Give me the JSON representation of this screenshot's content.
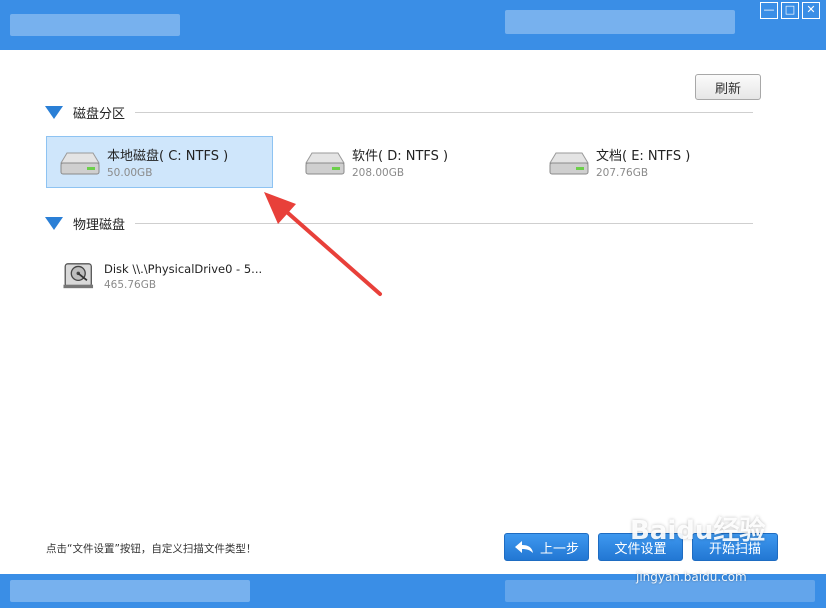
{
  "window": {
    "minimize": "—",
    "maximize": "□",
    "close": "✕"
  },
  "toolbar": {
    "refresh_label": "刷新"
  },
  "partitions": {
    "title": "磁盘分区",
    "items": [
      {
        "name": "本地磁盘( C: NTFS )",
        "size": "50.00GB",
        "selected": true
      },
      {
        "name": "软件( D: NTFS )",
        "size": "208.00GB",
        "selected": false
      },
      {
        "name": "文档( E: NTFS )",
        "size": "207.76GB",
        "selected": false
      }
    ]
  },
  "physical": {
    "title": "物理磁盘",
    "items": [
      {
        "name": "Disk \\\\.\\PhysicalDrive0 - 5...",
        "size": "465.76GB"
      }
    ]
  },
  "footer": {
    "hint": "点击“文件设置”按钮，自定义扫描文件类型！",
    "back_label": "上一步",
    "settings_label": "文件设置",
    "scan_label": "开始扫描"
  },
  "watermark": {
    "brand": "Baidu经验",
    "url": "jingyan.baidu.com"
  },
  "colors": {
    "accent": "#3a8ee6",
    "selected_bg": "#cfe6fb",
    "arrow": "#e8403a"
  }
}
